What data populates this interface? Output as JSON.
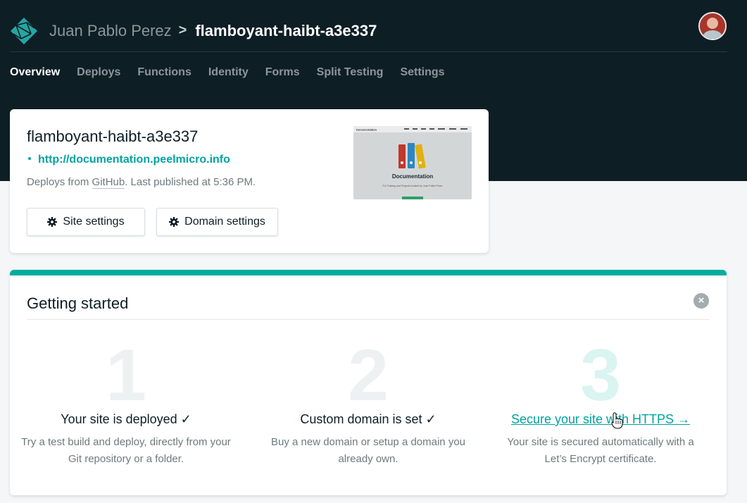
{
  "header": {
    "team_name": "Juan Pablo Perez",
    "separator": ">",
    "site_name": "flamboyant-haibt-a3e337"
  },
  "nav": {
    "items": [
      {
        "label": "Overview",
        "active": true
      },
      {
        "label": "Deploys"
      },
      {
        "label": "Functions"
      },
      {
        "label": "Identity"
      },
      {
        "label": "Forms"
      },
      {
        "label": "Split Testing"
      },
      {
        "label": "Settings"
      }
    ]
  },
  "site_card": {
    "title": "flamboyant-haibt-a3e337",
    "url": "http://documentation.peelmicro.info",
    "meta_prefix": "Deploys from ",
    "meta_source": "GitHub",
    "meta_suffix": ". Last published at 5:36 PM.",
    "site_settings_label": "Site settings",
    "domain_settings_label": "Domain settings",
    "thumbnail": {
      "heading": "Documentation",
      "subtitle": "For Training and Projects created by Juan Pablo Perez",
      "brand": "Documentation"
    }
  },
  "getting_started": {
    "title": "Getting started",
    "close_label": "×",
    "steps": [
      {
        "number": "1",
        "title": "Your site is deployed ✓",
        "description": "Try a test build and deploy, directly from your Git repository or a folder."
      },
      {
        "number": "2",
        "title": "Custom domain is set ✓",
        "description": "Buy a new domain or setup a domain you already own."
      },
      {
        "number": "3",
        "title": "Secure your site with HTTPS →",
        "description": "Your site is secured automatically with a Let’s Encrypt certificate."
      }
    ]
  },
  "colors": {
    "header_bg": "#0e1e25",
    "accent": "#00ad9f",
    "link": "#00a3a0"
  }
}
